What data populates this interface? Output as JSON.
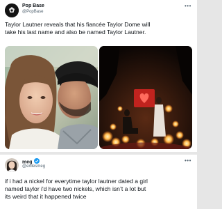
{
  "tweet1": {
    "display_name": "Pop Base",
    "handle": "@PopBase",
    "text_lines": [
      "Taylor Lautner reveals that his fiancée Taylor Dome will",
      "take his last name and also be named Taylor Lautner."
    ],
    "more_icon": "more-dots-icon",
    "photos": [
      "couple-kiss-photo",
      "proposal-candles-photo"
    ]
  },
  "tweet2": {
    "display_name": "meg",
    "verified_icon": "verified-badge-icon",
    "handle": "@exilesmeg",
    "text_lines": [
      "if i had a nickel for everytime taylor lautner dated a girl",
      "named taylor i'd have two nickels, which isn’t a lot but",
      "its weird that it happened twice"
    ],
    "more_icon": "more-dots-icon"
  },
  "colors": {
    "verified": "#1d9bf0",
    "secondary_text": "#536471"
  }
}
